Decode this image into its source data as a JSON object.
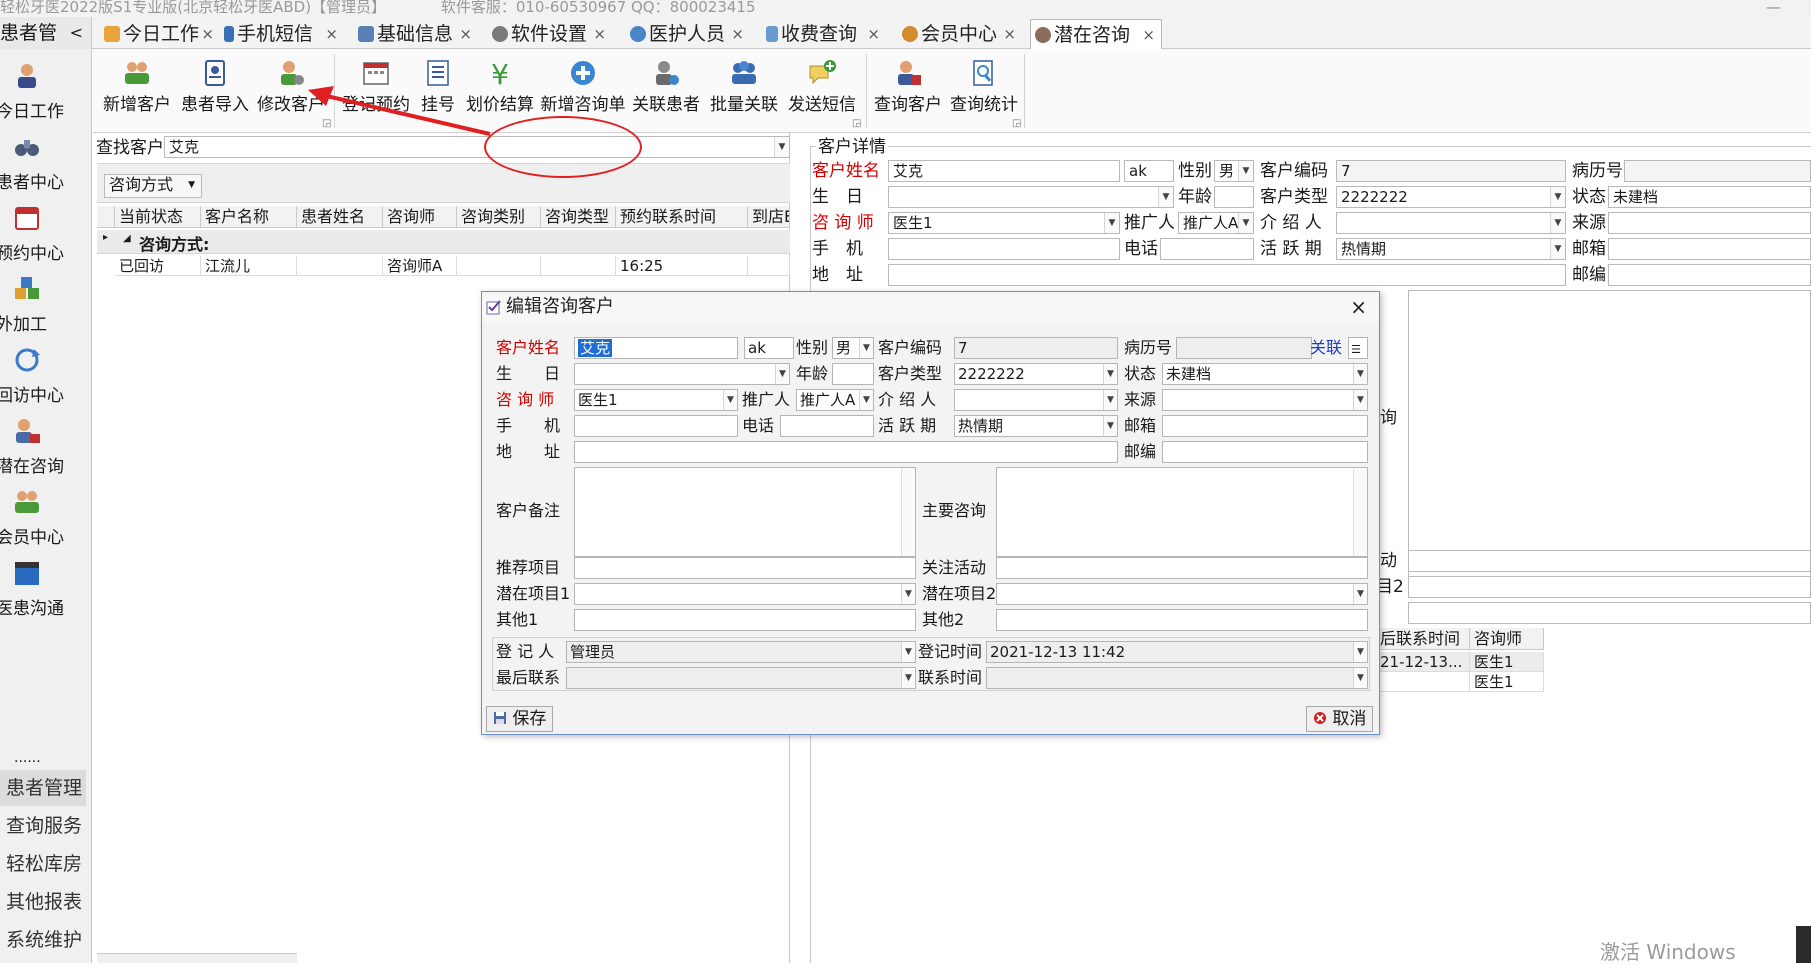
{
  "window": {
    "title": "轻松牙医2022版S1专业版(北京轻松牙医ABD)【管理员】",
    "service": "软件客服：010-60530967  QQ：800023415",
    "minimize": "—"
  },
  "nav_header": {
    "label": "患者管",
    "chevron": "<"
  },
  "tabs": [
    {
      "label": "今日工作",
      "icon": "house-icon"
    },
    {
      "label": "手机短信",
      "icon": "phone-icon"
    },
    {
      "label": "基础信息",
      "icon": "grid-icon"
    },
    {
      "label": "软件设置",
      "icon": "gear-icon"
    },
    {
      "label": "医护人员",
      "icon": "people-icon"
    },
    {
      "label": "收费查询",
      "icon": "chart-icon"
    },
    {
      "label": "会员中心",
      "icon": "members-icon"
    },
    {
      "label": "潜在咨询",
      "icon": "consult-icon"
    }
  ],
  "tab_close": "×",
  "left_nav": {
    "items": [
      {
        "label": "今日工作"
      },
      {
        "label": "患者中心"
      },
      {
        "label": "预约中心"
      },
      {
        "label": "外加工"
      },
      {
        "label": "回访中心"
      },
      {
        "label": "潜在咨询"
      },
      {
        "label": "会员中心"
      },
      {
        "label": "医患沟通"
      }
    ],
    "more": "......",
    "sections": [
      {
        "label": "患者管理"
      },
      {
        "label": "查询服务"
      },
      {
        "label": "轻松库房"
      },
      {
        "label": "其他报表"
      },
      {
        "label": "系统维护"
      }
    ]
  },
  "ribbon": {
    "buttons": [
      {
        "label": "新增客户"
      },
      {
        "label": "患者导入"
      },
      {
        "label": "修改客户"
      },
      {
        "label": "登记预约"
      },
      {
        "label": "挂号"
      },
      {
        "label": "划价结算"
      },
      {
        "label": "新增咨询单"
      },
      {
        "label": "关联患者"
      },
      {
        "label": "批量关联"
      },
      {
        "label": "发送短信"
      },
      {
        "label": "查询客户"
      },
      {
        "label": "查询统计"
      }
    ]
  },
  "search": {
    "label": "查找客户",
    "value": "艾克"
  },
  "group_by": {
    "value": "咨询方式"
  },
  "grid": {
    "columns": [
      "当前状态",
      "客户名称",
      "患者姓名",
      "咨询师",
      "咨询类别",
      "咨询类型",
      "预约联系时间",
      "到店E"
    ],
    "group_label": "咨询方式:",
    "rows": [
      [
        "已回访",
        "江流儿",
        "",
        "咨询师A",
        "",
        "",
        "16:25",
        ""
      ]
    ]
  },
  "detail": {
    "section_title": "客户详情",
    "name_label": "客户姓名",
    "name": "艾克",
    "pinyin": "ak",
    "gender_label": "性别",
    "gender": "男",
    "code_label": "客户编码",
    "code": "7",
    "record_label": "病历号",
    "birthday_label": "生　日",
    "age_label": "年龄",
    "type_label": "客户类型",
    "type": "2222222",
    "status_label": "状态",
    "status": "未建档",
    "consultant_label": "咨 询 师",
    "consultant": "医生1",
    "promoter_label": "推广人",
    "promoter": "推广人A",
    "referrer_label": "介 绍 人",
    "source_label": "来源",
    "mobile_label": "手　机",
    "phone_label": "电话",
    "active_label": "活 跃 期",
    "active": "热情期",
    "email_label": "邮箱",
    "address_label": "地　址",
    "zip_label": "邮编",
    "partial_consult": "询",
    "partial_activity": "动",
    "partial_item2": "目2",
    "sub_headers": [
      "后联系时间",
      "咨询师"
    ],
    "sub_rows": [
      [
        "21-12-13...",
        "医生1"
      ],
      [
        "",
        "医生1"
      ]
    ]
  },
  "dialog": {
    "title": "编辑咨询客户",
    "close": "×",
    "name_label": "客户姓名",
    "name": "艾克",
    "pinyin": "ak",
    "gender_label": "性别",
    "gender": "男",
    "code_label": "客户编码",
    "code": "7",
    "record_label": "病历号",
    "link": "关联",
    "birthday_label": "生　　日",
    "age_label": "年龄",
    "type_label": "客户类型",
    "type": "2222222",
    "status_label": "状态",
    "status": "未建档",
    "consultant_label": "咨 询 师",
    "consultant": "医生1",
    "promoter_label": "推广人",
    "promoter": "推广人A",
    "referrer_label": "介 绍 人",
    "source_label": "来源",
    "mobile_label": "手　　机",
    "phone_label": "电话",
    "active_label": "活 跃 期",
    "active": "热情期",
    "email_label": "邮箱",
    "address_label": "地　　址",
    "zip_label": "邮编",
    "remark_label": "客户备注",
    "main_consult_label": "主要咨询",
    "recommend_label": "推荐项目",
    "focus_label": "关注活动",
    "potential1_label": "潜在项目1",
    "potential2_label": "潜在项目2",
    "other1_label": "其他1",
    "other2_label": "其他2",
    "registrar_label": "登 记 人",
    "registrar": "管理员",
    "reg_time_label": "登记时间",
    "reg_time": "2021-12-13 11:42",
    "last_contact_label": "最后联系",
    "contact_time_label": "联系时间",
    "save": "保存",
    "cancel": "取消"
  },
  "watermark": "激活 Windows",
  "accent_color": "#d40000"
}
